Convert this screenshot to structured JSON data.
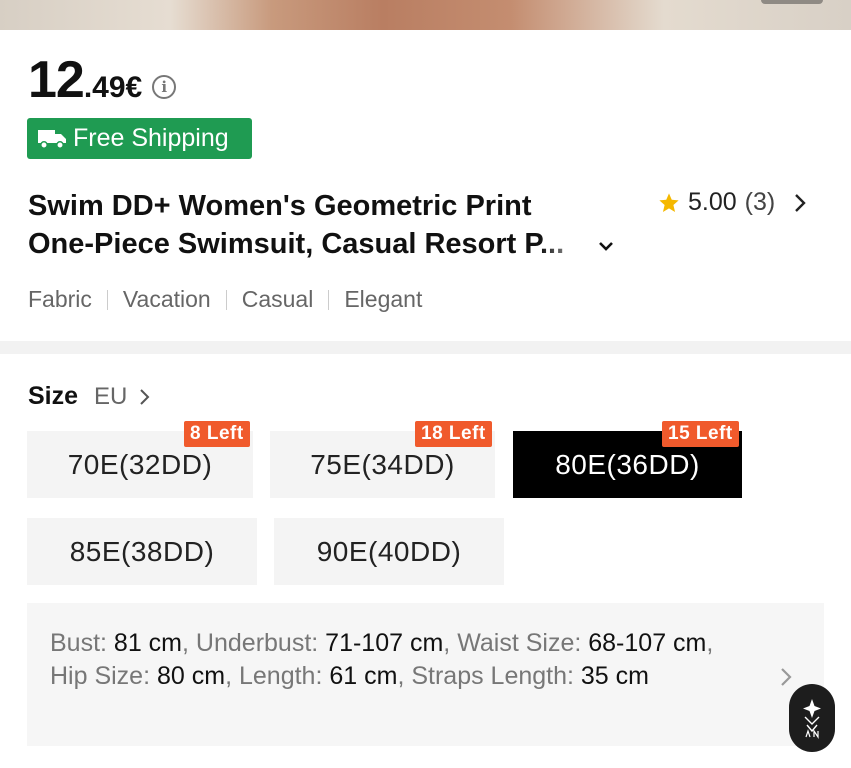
{
  "price": {
    "integer": "12",
    "decimal": ".49€"
  },
  "shipping": {
    "label": "Free Shipping",
    "color": "#1f9b52"
  },
  "product": {
    "title_line1": "Swim DD+ Women's Geometric Print",
    "title_line2": "One-Piece Swimsuit, Casual Resort P..."
  },
  "rating": {
    "score": "5.00",
    "count": "(3)"
  },
  "tags": [
    "Fabric",
    "Vacation",
    "Casual",
    "Elegant"
  ],
  "size": {
    "label": "Size",
    "unit": "EU",
    "options": [
      {
        "label": "70E(32DD)",
        "stock": "8 Left",
        "selected": false
      },
      {
        "label": "75E(34DD)",
        "stock": "18 Left",
        "selected": false
      },
      {
        "label": "80E(36DD)",
        "stock": "15 Left",
        "selected": true
      },
      {
        "label": "85E(38DD)",
        "stock": "",
        "selected": false
      },
      {
        "label": "90E(40DD)",
        "stock": "",
        "selected": false
      }
    ]
  },
  "measurements": [
    {
      "name": "Bust: ",
      "value": "81 cm"
    },
    {
      "name": "Underbust: ",
      "value": "71-107 cm"
    },
    {
      "name": "Waist Size: ",
      "value": "68-107 cm"
    },
    {
      "name": "Hip Size: ",
      "value": "80 cm"
    },
    {
      "name": "Length: ",
      "value": "61 cm"
    },
    {
      "name": "Straps Length: ",
      "value": "35 cm"
    }
  ],
  "colors": {
    "stock_badge": "#f05a2c",
    "selected": "#000000",
    "star": "#f5b800"
  },
  "icons": [
    "info-icon",
    "truck-icon",
    "star-icon",
    "chevron-right-icon",
    "chevron-down-icon",
    "assistant-badge-icon"
  ]
}
